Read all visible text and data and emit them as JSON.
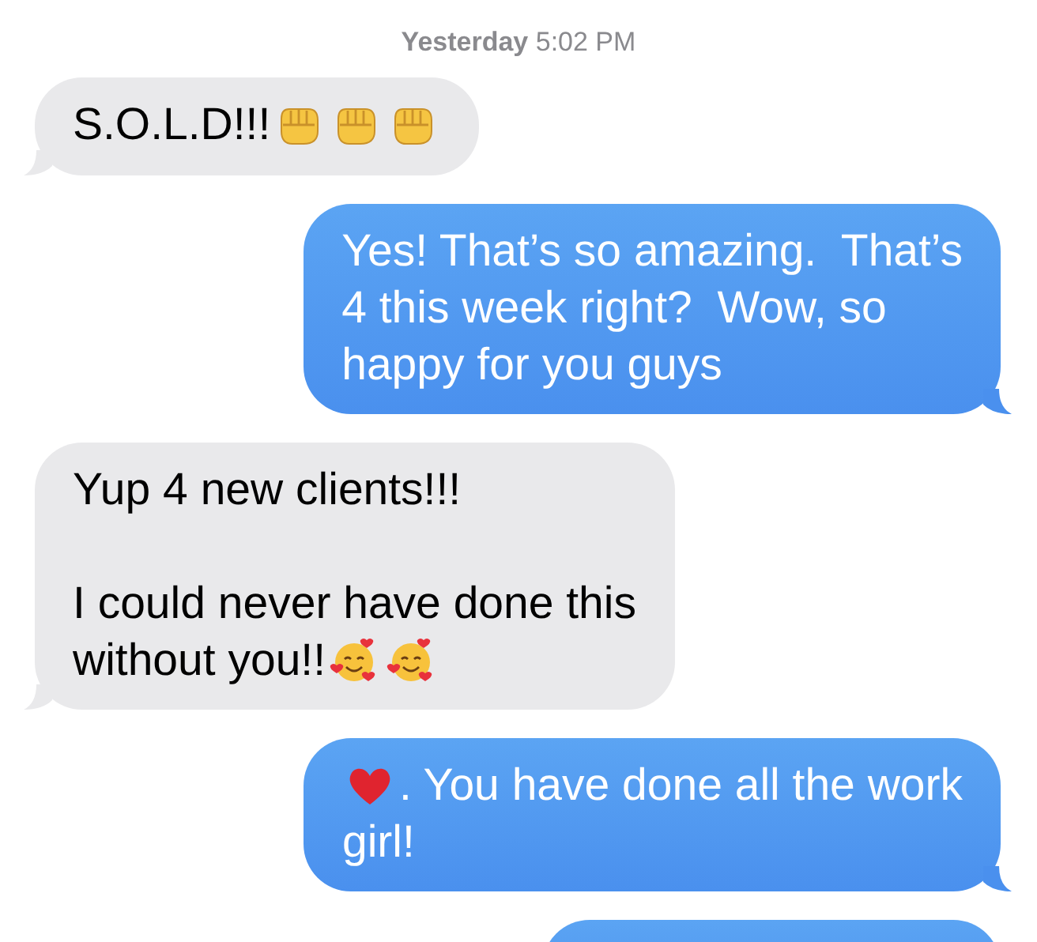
{
  "timestamp": "**Yesterday** 5:02 PM",
  "messages": [
    {
      "kind": "received",
      "paragraphs": [
        [
          {
            "parts": [
              {
                "kind": "text",
                "text": "S.O.L.D!!!"
              },
              {
                "kind": "fist"
              },
              {
                "kind": "fist"
              },
              {
                "kind": "fist"
              }
            ]
          }
        ]
      ]
    },
    {
      "kind": "sent",
      "paragraphs": [
        [
          {
            "parts": [
              {
                "kind": "text",
                "text": "Yes! That’s so amazing.  That’s"
              }
            ]
          },
          {
            "parts": [
              {
                "kind": "text",
                "text": "4 this week right?  Wow, so"
              }
            ]
          },
          {
            "parts": [
              {
                "kind": "text",
                "text": "happy for you guys"
              }
            ]
          }
        ]
      ]
    },
    {
      "kind": "received",
      "paragraphs": [
        [
          {
            "parts": [
              {
                "kind": "text",
                "text": "Yup 4 new clients!!!"
              }
            ]
          }
        ],
        [
          {
            "parts": [
              {
                "kind": "text",
                "text": "I could never have done this"
              }
            ]
          },
          {
            "parts": [
              {
                "kind": "text",
                "text": "without you!!"
              },
              {
                "kind": "smiling-hearts"
              },
              {
                "kind": "smiling-hearts"
              }
            ]
          }
        ]
      ]
    },
    {
      "kind": "sent",
      "paragraphs": [
        [
          {
            "parts": [
              {
                "kind": "heart"
              },
              {
                "kind": "text",
                "text": ". You have done all the work"
              }
            ]
          },
          {
            "parts": [
              {
                "kind": "text",
                "text": "girl!"
              }
            ]
          }
        ]
      ]
    },
    {
      "kind": "sent"
    }
  ]
}
